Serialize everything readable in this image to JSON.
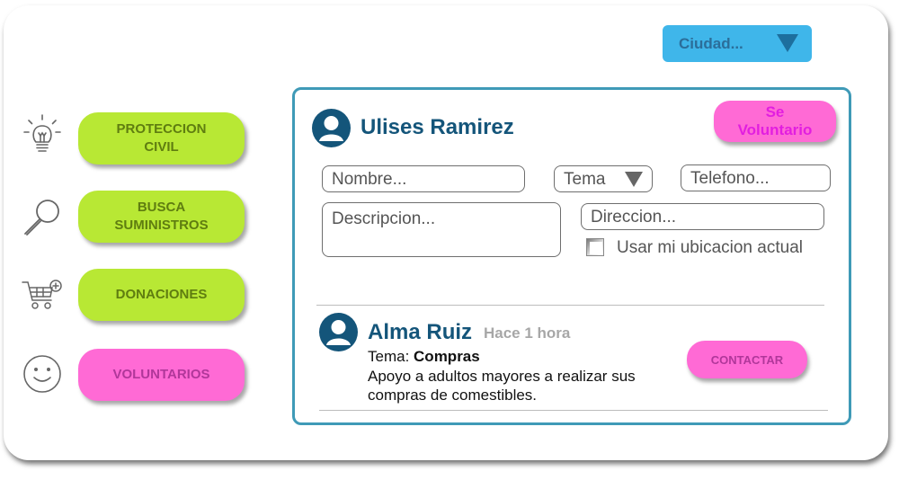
{
  "header": {
    "city_label": "Ciudad..."
  },
  "sidebar": {
    "items": [
      {
        "label": "PROTECCION\nCIVIL",
        "icon": "lightbulb-icon",
        "color": "#b8e834"
      },
      {
        "label": "BUSCA\nSUMINISTROS",
        "icon": "magnifier-icon",
        "color": "#b8e834"
      },
      {
        "label": "DONACIONES",
        "icon": "cart-add-icon",
        "color": "#b8e834"
      },
      {
        "label": "VOLUNTARIOS",
        "icon": "smiley-icon",
        "color": "#ff6ad5"
      }
    ]
  },
  "form": {
    "user_name": "Ulises Ramirez",
    "volunteer_button": "Se\nVoluntario",
    "name_placeholder": "Nombre...",
    "topic_placeholder": "Tema",
    "phone_placeholder": "Telefono...",
    "description_placeholder": "Descripcion...",
    "address_placeholder": "Direccion...",
    "use_location_label": "Usar mi ubicacion actual",
    "use_location_checked": false
  },
  "post": {
    "author": "Alma Ruiz",
    "time": "Hace 1 hora",
    "topic_label": "Tema:",
    "topic_value": "Compras",
    "description": "Apoyo a adultos mayores a realizar sus compras de comestibles.",
    "contact_button": "CONTACTAR"
  },
  "colors": {
    "accent_blue": "#3fb6ea",
    "panel_border": "#3f9ab7",
    "name_blue": "#14557a",
    "green": "#b8e834",
    "pink": "#ff6ad5"
  }
}
